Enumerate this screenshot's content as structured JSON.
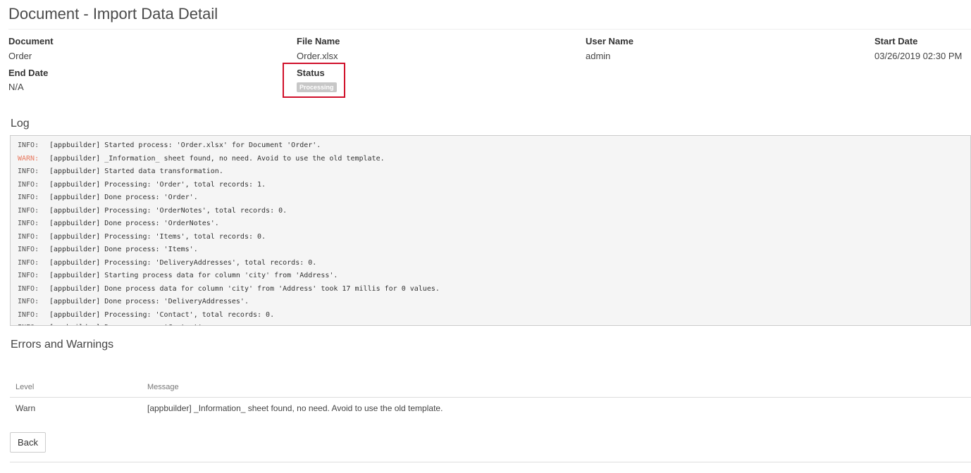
{
  "page": {
    "title": "Document - Import Data Detail"
  },
  "details": {
    "document_label": "Document",
    "document_value": "Order",
    "file_name_label": "File Name",
    "file_name_value": "Order.xlsx",
    "user_name_label": "User Name",
    "user_name_value": "admin",
    "start_date_label": "Start Date",
    "start_date_value": "03/26/2019 02:30 PM",
    "end_date_label": "End Date",
    "end_date_value": "N/A",
    "status_label": "Status",
    "status_value": "Processing"
  },
  "log": {
    "title": "Log",
    "lines": [
      {
        "level": "INFO:",
        "text": "[appbuilder] Started process: 'Order.xlsx' for Document 'Order'."
      },
      {
        "level": "WARN:",
        "text": "[appbuilder] _Information_ sheet found, no need. Avoid to use the old template."
      },
      {
        "level": "INFO:",
        "text": "[appbuilder] Started data transformation."
      },
      {
        "level": "INFO:",
        "text": "[appbuilder] Processing: 'Order', total records: 1."
      },
      {
        "level": "INFO:",
        "text": "[appbuilder] Done process: 'Order'."
      },
      {
        "level": "INFO:",
        "text": "[appbuilder] Processing: 'OrderNotes', total records: 0."
      },
      {
        "level": "INFO:",
        "text": "[appbuilder] Done process: 'OrderNotes'."
      },
      {
        "level": "INFO:",
        "text": "[appbuilder] Processing: 'Items', total records: 0."
      },
      {
        "level": "INFO:",
        "text": "[appbuilder] Done process: 'Items'."
      },
      {
        "level": "INFO:",
        "text": "[appbuilder] Processing: 'DeliveryAddresses', total records: 0."
      },
      {
        "level": "INFO:",
        "text": "[appbuilder] Starting process data for column 'city' from 'Address'."
      },
      {
        "level": "INFO:",
        "text": "[appbuilder] Done process data for column 'city' from 'Address' took 17 millis for 0 values."
      },
      {
        "level": "INFO:",
        "text": "[appbuilder] Done process: 'DeliveryAddresses'."
      },
      {
        "level": "INFO:",
        "text": "[appbuilder] Processing: 'Contact', total records: 0."
      },
      {
        "level": "INFO:",
        "text": "[appbuilder] Done process: 'Contact'."
      }
    ]
  },
  "errors": {
    "title": "Errors and Warnings",
    "columns": {
      "level": "Level",
      "message": "Message"
    },
    "rows": [
      {
        "level": "Warn",
        "message": "[appbuilder] _Information_ sheet found, no need. Avoid to use the old template."
      }
    ]
  },
  "actions": {
    "back_label": "Back"
  },
  "colors": {
    "warn": "#e8795f",
    "highlight_border": "#d0102a",
    "status_badge": "#c7c7c7"
  }
}
